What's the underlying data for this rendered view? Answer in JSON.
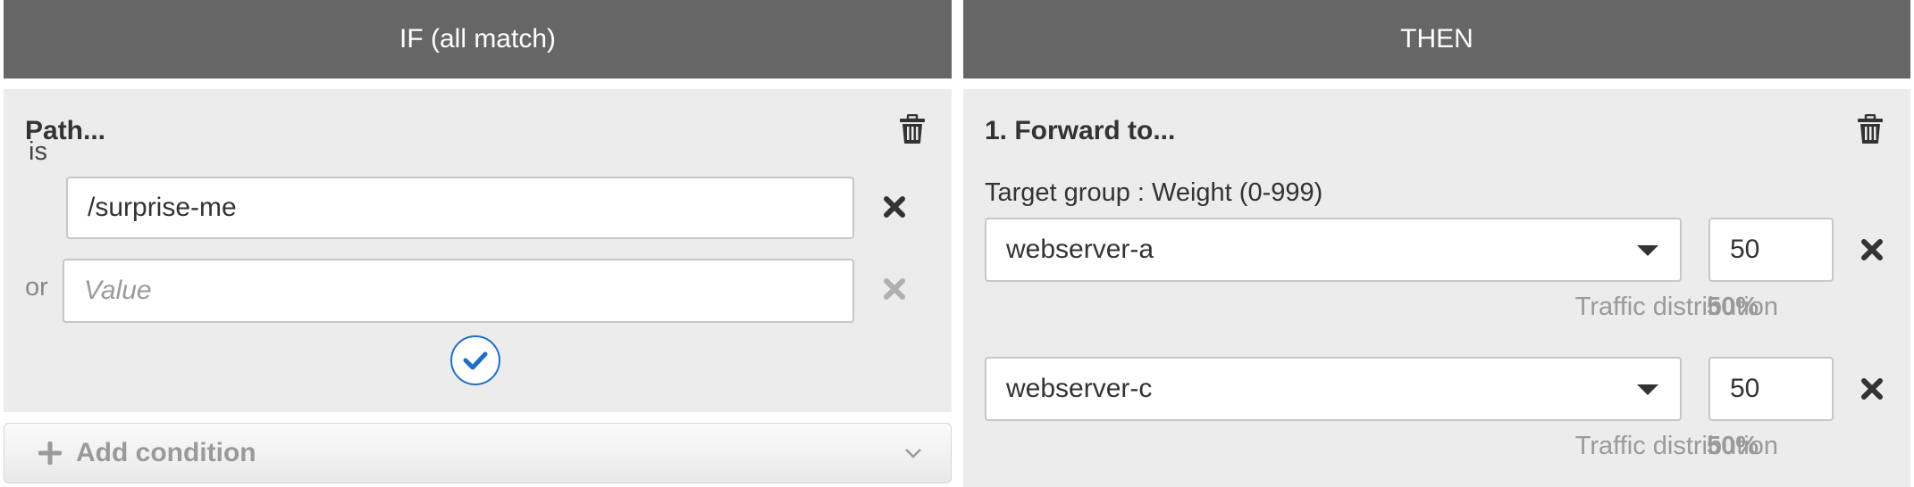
{
  "if_column": {
    "header": "IF (all match)",
    "condition_title": "Path...",
    "rows": [
      {
        "label": "is",
        "value": "/surprise-me",
        "placeholder": ""
      },
      {
        "label": "or",
        "value": "",
        "placeholder": "Value"
      }
    ],
    "add_condition_label": "Add condition"
  },
  "then_column": {
    "header": "THEN",
    "action_title": "1. Forward to...",
    "target_label": "Target group : Weight (0-999)",
    "targets": [
      {
        "group": "webserver-a",
        "weight": "50",
        "distribution_label": "Traffic distribution",
        "distribution_value": "50%"
      },
      {
        "group": "webserver-c",
        "weight": "50",
        "distribution_label": "Traffic distribution",
        "distribution_value": "50%"
      }
    ]
  },
  "colors": {
    "header_bg": "#666666",
    "panel_bg": "#ececec",
    "accent": "#1f6fc5",
    "icon_dark": "#333333",
    "icon_muted": "#9a9a9a"
  },
  "icons": [
    "trash-icon",
    "close-icon",
    "checkmark-icon",
    "plus-icon",
    "chevron-down-icon",
    "caret-down-icon"
  ]
}
